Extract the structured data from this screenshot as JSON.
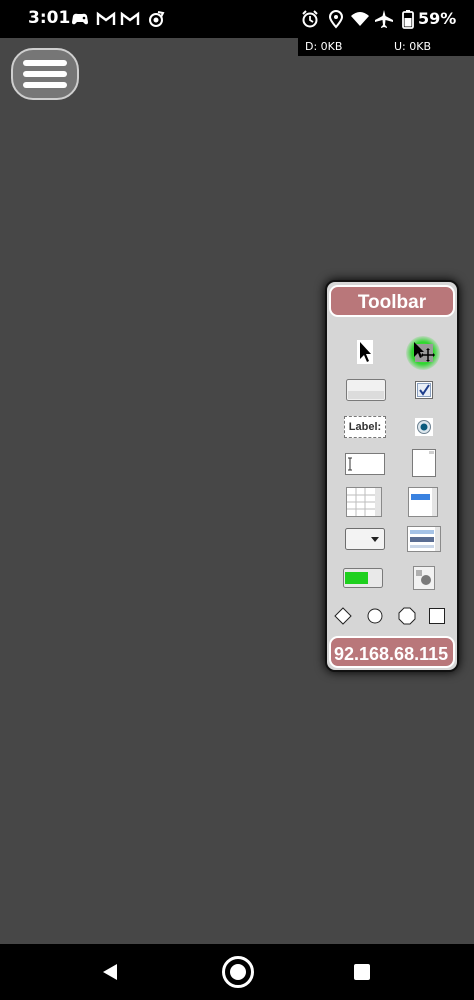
{
  "status_bar": {
    "time": "3:01",
    "left_icons": [
      "game-controller-icon",
      "gmail-icon",
      "gmail-icon",
      "sync-icon"
    ],
    "right_icons": [
      "alarm-icon",
      "location-icon",
      "wifi-icon",
      "airplane-icon",
      "battery-icon"
    ],
    "battery": "59%"
  },
  "net_stats": {
    "download": "D: 0KB",
    "upload": "U: 0KB"
  },
  "toolbar": {
    "title": "Toolbar",
    "ip": "92.168.68.115",
    "tools": [
      "pointer-tool",
      "move-tool",
      "button-tool",
      "checkbox-tool",
      "label-tool",
      "radio-tool",
      "textfield-tool",
      "textarea-tool",
      "table-tool",
      "listbox-tool",
      "dropdown-tool",
      "list-tool",
      "progressbar-tool",
      "image-tool",
      "diamond-shape",
      "circle-shape",
      "octagon-shape",
      "square-shape"
    ],
    "label_tool_text": "Label:"
  },
  "nav_bar": {
    "buttons": [
      "back-button",
      "home-button",
      "recents-button"
    ]
  },
  "colors": {
    "background": "#474747",
    "toolbar_accent": "#b9777a",
    "toolbar_panel": "#d6d6d6",
    "glow": "#3ad43a"
  }
}
